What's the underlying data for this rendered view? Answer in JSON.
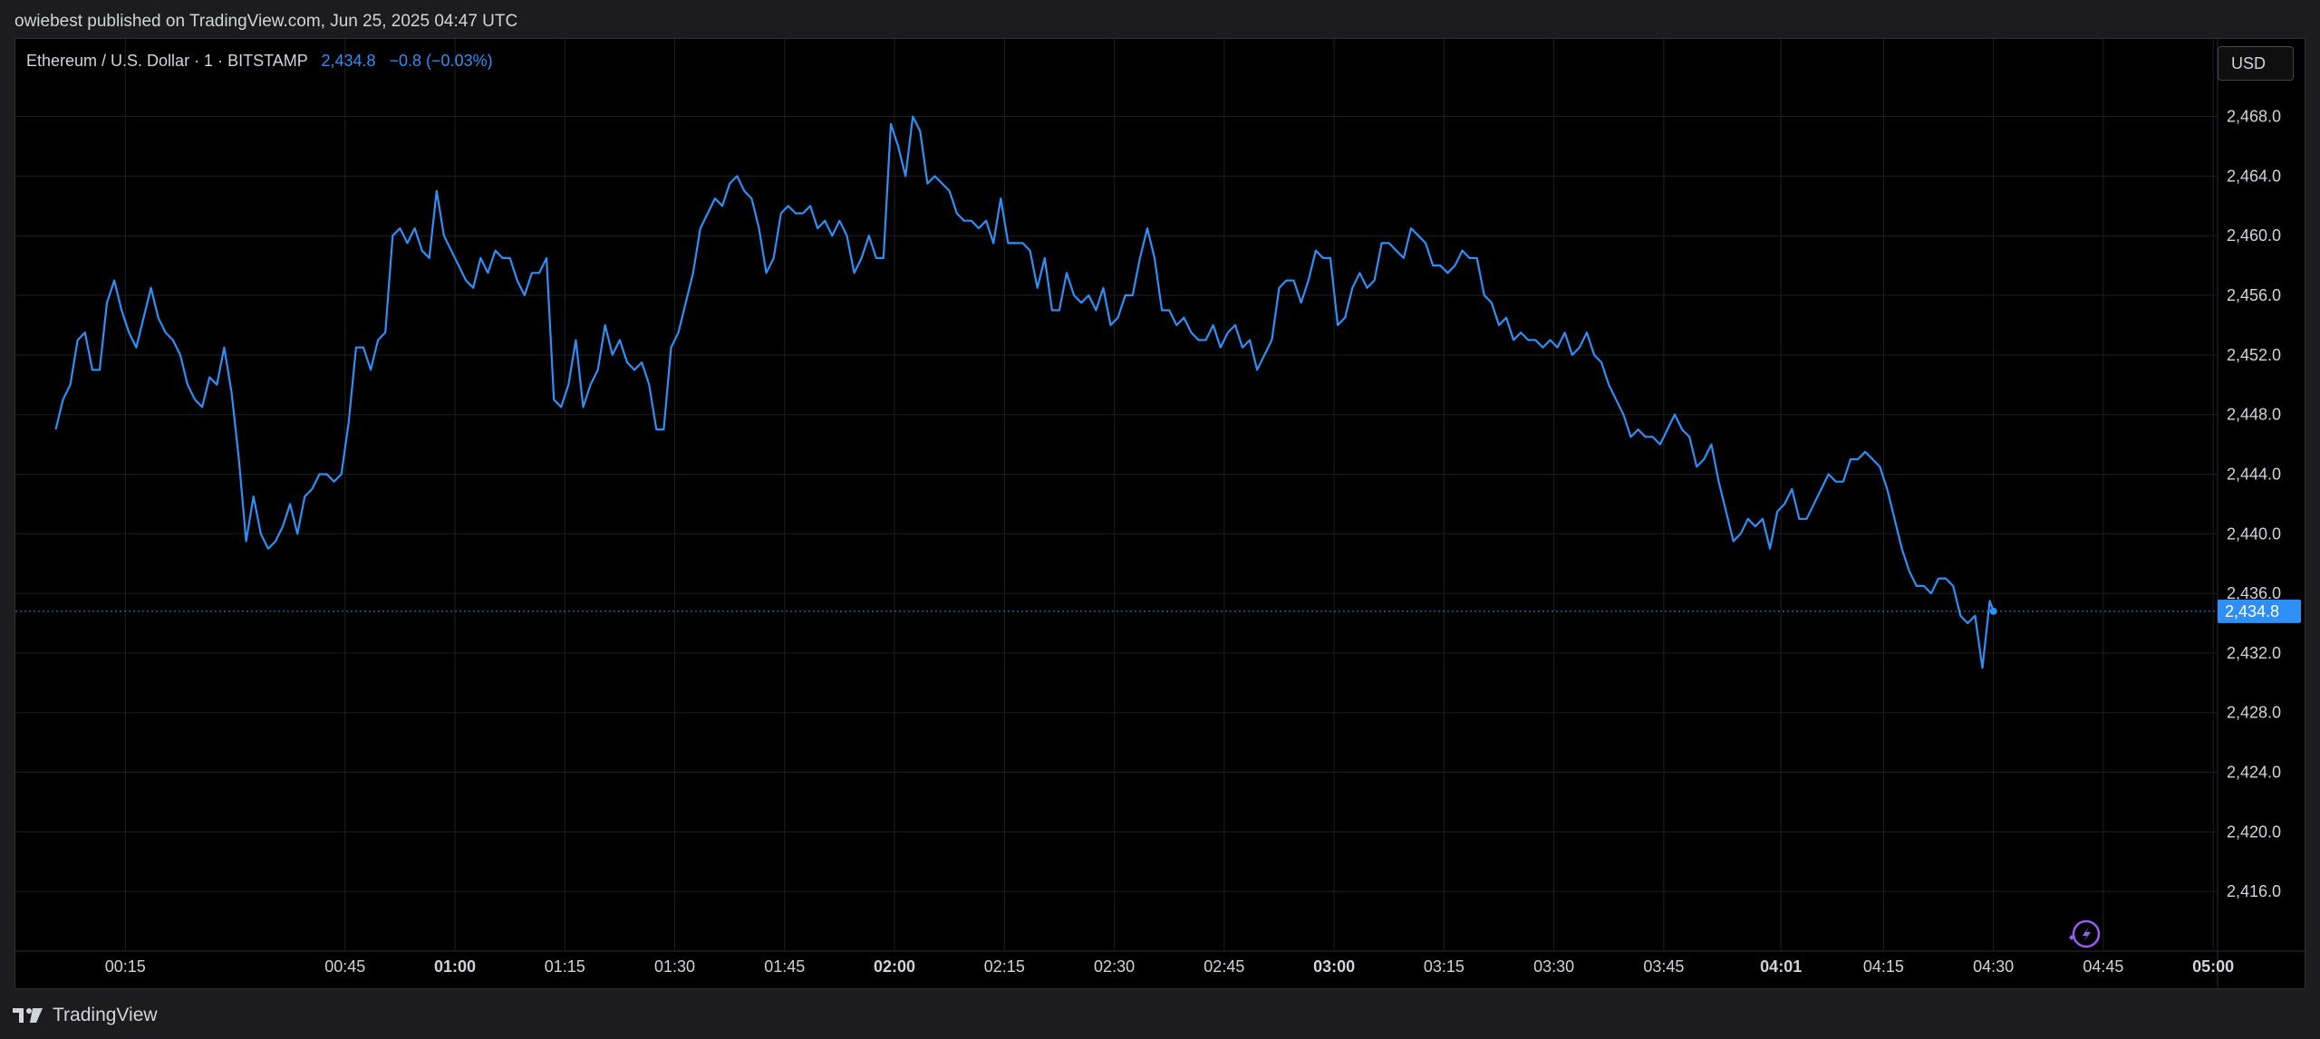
{
  "header": {
    "published_text": "owiebest published on TradingView.com, Jun 25, 2025 04:47 UTC"
  },
  "legend": {
    "symbol": "Ethereum / U.S. Dollar · 1 · BITSTAMP",
    "price": "2,434.8",
    "change": "−0.8 (−0.03%)"
  },
  "currency_button": "USD",
  "footer": {
    "brand": "TradingView"
  },
  "colors": {
    "line": "#2e8ff7",
    "background": "#000000",
    "grid": "#1f1f23",
    "price_label_bg": "#2e8ff7",
    "badge": "#9c5cf5"
  },
  "chart_data": {
    "type": "line",
    "title": "",
    "xlabel": "",
    "ylabel": "",
    "ylim": [
      2412.0,
      2473.2
    ],
    "y_ticks": [
      {
        "value": 2416.0,
        "label": "2,416.0"
      },
      {
        "value": 2420.0,
        "label": "2,420.0"
      },
      {
        "value": 2424.0,
        "label": "2,424.0"
      },
      {
        "value": 2428.0,
        "label": "2,428.0"
      },
      {
        "value": 2432.0,
        "label": "2,432.0"
      },
      {
        "value": 2436.0,
        "label": "2,436.0"
      },
      {
        "value": 2440.0,
        "label": "2,440.0"
      },
      {
        "value": 2444.0,
        "label": "2,444.0"
      },
      {
        "value": 2448.0,
        "label": "2,448.0"
      },
      {
        "value": 2452.0,
        "label": "2,452.0"
      },
      {
        "value": 2456.0,
        "label": "2,456.0"
      },
      {
        "value": 2460.0,
        "label": "2,460.0"
      },
      {
        "value": 2464.0,
        "label": "2,464.0"
      },
      {
        "value": 2468.0,
        "label": "2,468.0"
      }
    ],
    "x_ticks": [
      {
        "t": 15,
        "label": "00:15",
        "bold": false
      },
      {
        "t": 45,
        "label": "00:45",
        "bold": false
      },
      {
        "t": 60,
        "label": "01:00",
        "bold": true
      },
      {
        "t": 75,
        "label": "01:15",
        "bold": false
      },
      {
        "t": 90,
        "label": "01:30",
        "bold": false
      },
      {
        "t": 105,
        "label": "01:45",
        "bold": false
      },
      {
        "t": 120,
        "label": "02:00",
        "bold": true
      },
      {
        "t": 135,
        "label": "02:15",
        "bold": false
      },
      {
        "t": 150,
        "label": "02:30",
        "bold": false
      },
      {
        "t": 165,
        "label": "02:45",
        "bold": false
      },
      {
        "t": 180,
        "label": "03:00",
        "bold": true
      },
      {
        "t": 195,
        "label": "03:15",
        "bold": false
      },
      {
        "t": 210,
        "label": "03:30",
        "bold": false
      },
      {
        "t": 225,
        "label": "03:45",
        "bold": false
      },
      {
        "t": 241,
        "label": "04:01",
        "bold": true
      },
      {
        "t": 255,
        "label": "04:15",
        "bold": false
      },
      {
        "t": 270,
        "label": "04:30",
        "bold": false
      },
      {
        "t": 285,
        "label": "04:45",
        "bold": false
      },
      {
        "t": 300,
        "label": "05:00",
        "bold": true
      }
    ],
    "last_price": {
      "value": 2434.8,
      "label": "2,434.8"
    },
    "series": [
      {
        "values": [
          [
            5.5,
            2447.0
          ],
          [
            6.5,
            2449.0
          ],
          [
            7.5,
            2450.0
          ],
          [
            8.5,
            2453.0
          ],
          [
            9.5,
            2453.5
          ],
          [
            10.5,
            2451.0
          ],
          [
            11.5,
            2451.0
          ],
          [
            12.5,
            2455.5
          ],
          [
            13.5,
            2457.0
          ],
          [
            14.5,
            2455.0
          ],
          [
            15.5,
            2453.5
          ],
          [
            16.5,
            2452.5
          ],
          [
            17.5,
            2454.5
          ],
          [
            18.5,
            2456.5
          ],
          [
            19.5,
            2454.5
          ],
          [
            20.5,
            2453.5
          ],
          [
            21.5,
            2453.0
          ],
          [
            22.5,
            2452.0
          ],
          [
            23.5,
            2450.0
          ],
          [
            24.5,
            2449.0
          ],
          [
            25.5,
            2448.5
          ],
          [
            26.5,
            2450.5
          ],
          [
            27.5,
            2450.0
          ],
          [
            28.5,
            2452.5
          ],
          [
            29.5,
            2449.5
          ],
          [
            30.5,
            2445.0
          ],
          [
            31.5,
            2439.5
          ],
          [
            32.5,
            2442.5
          ],
          [
            33.5,
            2440.0
          ],
          [
            34.5,
            2439.0
          ],
          [
            35.5,
            2439.5
          ],
          [
            36.5,
            2440.5
          ],
          [
            37.5,
            2442.0
          ],
          [
            38.5,
            2440.0
          ],
          [
            39.5,
            2442.5
          ],
          [
            40.5,
            2443.0
          ],
          [
            41.5,
            2444.0
          ],
          [
            42.5,
            2444.0
          ],
          [
            43.5,
            2443.5
          ],
          [
            44.5,
            2444.0
          ],
          [
            45.5,
            2447.5
          ],
          [
            46.5,
            2452.5
          ],
          [
            47.5,
            2452.5
          ],
          [
            48.5,
            2451.0
          ],
          [
            49.5,
            2453.0
          ],
          [
            50.5,
            2453.5
          ],
          [
            51.5,
            2460.0
          ],
          [
            52.5,
            2460.5
          ],
          [
            53.5,
            2459.5
          ],
          [
            54.5,
            2460.5
          ],
          [
            55.5,
            2459.0
          ],
          [
            56.5,
            2458.5
          ],
          [
            57.5,
            2463.0
          ],
          [
            58.5,
            2460.0
          ],
          [
            59.5,
            2459.0
          ],
          [
            60.5,
            2458.0
          ],
          [
            61.5,
            2457.0
          ],
          [
            62.5,
            2456.5
          ],
          [
            63.5,
            2458.5
          ],
          [
            64.5,
            2457.5
          ],
          [
            65.5,
            2459.0
          ],
          [
            66.5,
            2458.5
          ],
          [
            67.5,
            2458.5
          ],
          [
            68.5,
            2457.0
          ],
          [
            69.5,
            2456.0
          ],
          [
            70.5,
            2457.5
          ],
          [
            71.5,
            2457.5
          ],
          [
            72.5,
            2458.5
          ],
          [
            73.5,
            2449.0
          ],
          [
            74.5,
            2448.5
          ],
          [
            75.5,
            2450.0
          ],
          [
            76.5,
            2453.0
          ],
          [
            77.5,
            2448.5
          ],
          [
            78.5,
            2450.0
          ],
          [
            79.5,
            2451.0
          ],
          [
            80.5,
            2454.0
          ],
          [
            81.5,
            2452.0
          ],
          [
            82.5,
            2453.0
          ],
          [
            83.5,
            2451.5
          ],
          [
            84.5,
            2451.0
          ],
          [
            85.5,
            2451.5
          ],
          [
            86.5,
            2450.0
          ],
          [
            87.5,
            2447.0
          ],
          [
            88.5,
            2447.0
          ],
          [
            89.5,
            2452.5
          ],
          [
            90.5,
            2453.5
          ],
          [
            91.5,
            2455.5
          ],
          [
            92.5,
            2457.5
          ],
          [
            93.5,
            2460.5
          ],
          [
            94.5,
            2461.5
          ],
          [
            95.5,
            2462.5
          ],
          [
            96.5,
            2462.0
          ],
          [
            97.5,
            2463.5
          ],
          [
            98.5,
            2464.0
          ],
          [
            99.5,
            2463.0
          ],
          [
            100.5,
            2462.5
          ],
          [
            101.5,
            2460.5
          ],
          [
            102.5,
            2457.5
          ],
          [
            103.5,
            2458.5
          ],
          [
            104.5,
            2461.5
          ],
          [
            105.5,
            2462.0
          ],
          [
            106.5,
            2461.5
          ],
          [
            107.5,
            2461.5
          ],
          [
            108.5,
            2462.0
          ],
          [
            109.5,
            2460.5
          ],
          [
            110.5,
            2461.0
          ],
          [
            111.5,
            2460.0
          ],
          [
            112.5,
            2461.0
          ],
          [
            113.5,
            2460.0
          ],
          [
            114.5,
            2457.5
          ],
          [
            115.5,
            2458.5
          ],
          [
            116.5,
            2460.0
          ],
          [
            117.5,
            2458.5
          ],
          [
            118.5,
            2458.5
          ],
          [
            119.5,
            2467.5
          ],
          [
            120.5,
            2466.0
          ],
          [
            121.5,
            2464.0
          ],
          [
            122.5,
            2468.0
          ],
          [
            123.5,
            2467.0
          ],
          [
            124.5,
            2463.5
          ],
          [
            125.5,
            2464.0
          ],
          [
            126.5,
            2463.5
          ],
          [
            127.5,
            2463.0
          ],
          [
            128.5,
            2461.5
          ],
          [
            129.5,
            2461.0
          ],
          [
            130.5,
            2461.0
          ],
          [
            131.5,
            2460.5
          ],
          [
            132.5,
            2461.0
          ],
          [
            133.5,
            2459.5
          ],
          [
            134.5,
            2462.5
          ],
          [
            135.5,
            2459.5
          ],
          [
            136.5,
            2459.5
          ],
          [
            137.5,
            2459.5
          ],
          [
            138.5,
            2459.0
          ],
          [
            139.5,
            2456.5
          ],
          [
            140.5,
            2458.5
          ],
          [
            141.5,
            2455.0
          ],
          [
            142.5,
            2455.0
          ],
          [
            143.5,
            2457.5
          ],
          [
            144.5,
            2456.0
          ],
          [
            145.5,
            2455.5
          ],
          [
            146.5,
            2456.0
          ],
          [
            147.5,
            2455.0
          ],
          [
            148.5,
            2456.5
          ],
          [
            149.5,
            2454.0
          ],
          [
            150.5,
            2454.5
          ],
          [
            151.5,
            2456.0
          ],
          [
            152.5,
            2456.0
          ],
          [
            153.5,
            2458.5
          ],
          [
            154.5,
            2460.5
          ],
          [
            155.5,
            2458.5
          ],
          [
            156.5,
            2455.0
          ],
          [
            157.5,
            2455.0
          ],
          [
            158.5,
            2454.0
          ],
          [
            159.5,
            2454.5
          ],
          [
            160.5,
            2453.5
          ],
          [
            161.5,
            2453.0
          ],
          [
            162.5,
            2453.0
          ],
          [
            163.5,
            2454.0
          ],
          [
            164.5,
            2452.5
          ],
          [
            165.5,
            2453.5
          ],
          [
            166.5,
            2454.0
          ],
          [
            167.5,
            2452.5
          ],
          [
            168.5,
            2453.0
          ],
          [
            169.5,
            2451.0
          ],
          [
            170.5,
            2452.0
          ],
          [
            171.5,
            2453.0
          ],
          [
            172.5,
            2456.5
          ],
          [
            173.5,
            2457.0
          ],
          [
            174.5,
            2457.0
          ],
          [
            175.5,
            2455.5
          ],
          [
            176.5,
            2457.0
          ],
          [
            177.5,
            2459.0
          ],
          [
            178.5,
            2458.5
          ],
          [
            179.5,
            2458.5
          ],
          [
            180.5,
            2454.0
          ],
          [
            181.5,
            2454.5
          ],
          [
            182.5,
            2456.5
          ],
          [
            183.5,
            2457.5
          ],
          [
            184.5,
            2456.5
          ],
          [
            185.5,
            2457.0
          ],
          [
            186.5,
            2459.5
          ],
          [
            187.5,
            2459.5
          ],
          [
            188.5,
            2459.0
          ],
          [
            189.5,
            2458.5
          ],
          [
            190.5,
            2460.5
          ],
          [
            191.5,
            2460.0
          ],
          [
            192.5,
            2459.5
          ],
          [
            193.5,
            2458.0
          ],
          [
            194.5,
            2458.0
          ],
          [
            195.5,
            2457.5
          ],
          [
            196.5,
            2458.0
          ],
          [
            197.5,
            2459.0
          ],
          [
            198.5,
            2458.5
          ],
          [
            199.5,
            2458.5
          ],
          [
            200.5,
            2456.0
          ],
          [
            201.5,
            2455.5
          ],
          [
            202.5,
            2454.0
          ],
          [
            203.5,
            2454.5
          ],
          [
            204.5,
            2453.0
          ],
          [
            205.5,
            2453.5
          ],
          [
            206.5,
            2453.0
          ],
          [
            207.5,
            2453.0
          ],
          [
            208.5,
            2452.5
          ],
          [
            209.5,
            2453.0
          ],
          [
            210.5,
            2452.5
          ],
          [
            211.5,
            2453.5
          ],
          [
            212.5,
            2452.0
          ],
          [
            213.5,
            2452.5
          ],
          [
            214.5,
            2453.5
          ],
          [
            215.5,
            2452.0
          ],
          [
            216.5,
            2451.5
          ],
          [
            217.5,
            2450.0
          ],
          [
            218.5,
            2449.0
          ],
          [
            219.5,
            2448.0
          ],
          [
            220.5,
            2446.5
          ],
          [
            221.5,
            2447.0
          ],
          [
            222.5,
            2446.5
          ],
          [
            223.5,
            2446.5
          ],
          [
            224.5,
            2446.0
          ],
          [
            225.5,
            2447.0
          ],
          [
            226.5,
            2448.0
          ],
          [
            227.5,
            2447.0
          ],
          [
            228.5,
            2446.5
          ],
          [
            229.5,
            2444.5
          ],
          [
            230.5,
            2445.0
          ],
          [
            231.5,
            2446.0
          ],
          [
            232.5,
            2443.5
          ],
          [
            233.5,
            2441.5
          ],
          [
            234.5,
            2439.5
          ],
          [
            235.5,
            2440.0
          ],
          [
            236.5,
            2441.0
          ],
          [
            237.5,
            2440.5
          ],
          [
            238.5,
            2441.0
          ],
          [
            239.5,
            2439.0
          ],
          [
            240.5,
            2441.5
          ],
          [
            241.5,
            2442.0
          ],
          [
            242.5,
            2443.0
          ],
          [
            243.5,
            2441.0
          ],
          [
            244.5,
            2441.0
          ],
          [
            245.5,
            2442.0
          ],
          [
            246.5,
            2443.0
          ],
          [
            247.5,
            2444.0
          ],
          [
            248.5,
            2443.5
          ],
          [
            249.5,
            2443.5
          ],
          [
            250.5,
            2445.0
          ],
          [
            251.5,
            2445.0
          ],
          [
            252.5,
            2445.5
          ],
          [
            253.5,
            2445.0
          ],
          [
            254.5,
            2444.5
          ],
          [
            255.5,
            2443.0
          ],
          [
            256.5,
            2441.0
          ],
          [
            257.5,
            2439.0
          ],
          [
            258.5,
            2437.5
          ],
          [
            259.5,
            2436.5
          ],
          [
            260.5,
            2436.5
          ],
          [
            261.5,
            2436.0
          ],
          [
            262.5,
            2437.0
          ],
          [
            263.5,
            2437.0
          ],
          [
            264.5,
            2436.5
          ],
          [
            265.5,
            2434.5
          ],
          [
            266.5,
            2434.0
          ],
          [
            267.5,
            2434.5
          ],
          [
            268.5,
            2431.0
          ],
          [
            269.5,
            2435.5
          ],
          [
            270.0,
            2434.8
          ]
        ]
      }
    ]
  }
}
